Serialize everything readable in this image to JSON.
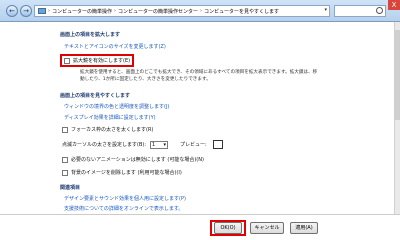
{
  "addressbar": {
    "crumbs": [
      "コンピューターの簡単操作",
      "コンピューターの簡単操作センター",
      "コンピューターを見やすくします"
    ]
  },
  "window": {
    "close_label": "X"
  },
  "nav": {
    "back": "←",
    "forward": "→"
  },
  "sections": {
    "magnify": {
      "title": "画面上の項目を拡大します",
      "link": "テキストとアイコンのサイズを変更します(Z)",
      "checkbox_label": "拡大鏡を有効にします(E)",
      "description": "拡大鏡を使用すると、画面上のどこでも拡大でき、その領域にあるすべての項目を拡大表示できます。拡大鏡は、移動したり、1か所に固定したり、大きさを変更したりできます。"
    },
    "visibility": {
      "title": "画面上の項目を見やすくします",
      "link1": "ウィンドウの境界の色と透明度を調整します(J)",
      "link2": "ディスプレイ効果を詳細に設定します(Y)",
      "focus_checkbox": "フォーカス枠の太さを太くします(R)",
      "cursor_label": "点滅カーソルの太さを設定します(B):",
      "cursor_value": "1",
      "preview_label": "プレビュー:",
      "animation_checkbox": "必要のないアニメーションは無効にします (可能な場合)(N)",
      "background_checkbox": "背景のイメージを削除します (利用可能な場合)(I)"
    },
    "related": {
      "title": "関連項目",
      "link1": "デザイン要素とサウンド効果を個人用に設定します(P)",
      "link2": "支援技術についての詳細をオンラインで表示します。"
    }
  },
  "footer": {
    "ok": "OK(O)",
    "cancel": "キャンセル",
    "apply": "適用(A)"
  }
}
